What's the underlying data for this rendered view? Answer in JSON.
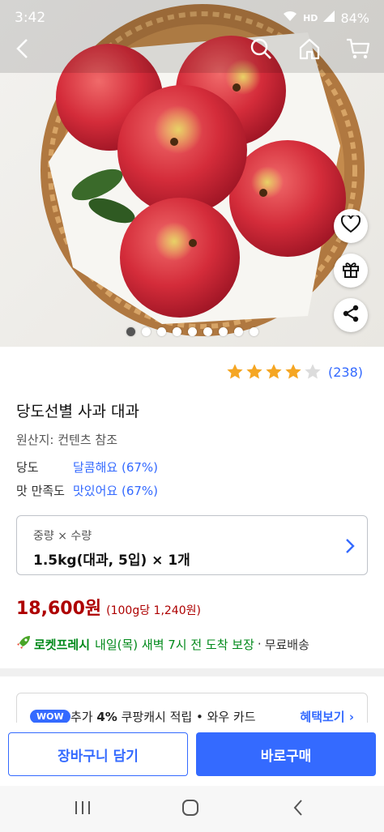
{
  "status_bar": {
    "time": "3:42",
    "network": "HD",
    "battery": "84%"
  },
  "gallery": {
    "total_images": 9,
    "active_index": 0
  },
  "product": {
    "rating": 4,
    "rating_max": 5,
    "review_count": "(238)",
    "title": "당도선별 사과 대과",
    "origin": "원산지: 컨텐츠 참조",
    "attributes": [
      {
        "key": "당도",
        "value": "달콤해요 (67%)"
      },
      {
        "key": "맛 만족도",
        "value": "맛있어요 (67%)"
      }
    ]
  },
  "option": {
    "label": "중량 × 수량",
    "value": "1.5kg(대과, 5입) × 1개"
  },
  "price": {
    "amount": "18,600원",
    "unit_price": "(100g당 1,240원)"
  },
  "delivery": {
    "brand": "로켓프레시",
    "schedule": "내일(목) 새벽 7시 전 도착 보장",
    "separator": "·",
    "free": "무료배송"
  },
  "benefit": {
    "badge": "WOW",
    "prefix": "추가 ",
    "percent": "4%",
    "suffix": " 쿠팡캐시 적립  •  와우 카드",
    "more": "혜택보기"
  },
  "actions": {
    "cart": "장바구니 담기",
    "buy": "바로구매"
  },
  "colors": {
    "accent": "#346aff",
    "price": "#ae0000",
    "rocket": "#00891a",
    "star": "#f5a623"
  }
}
